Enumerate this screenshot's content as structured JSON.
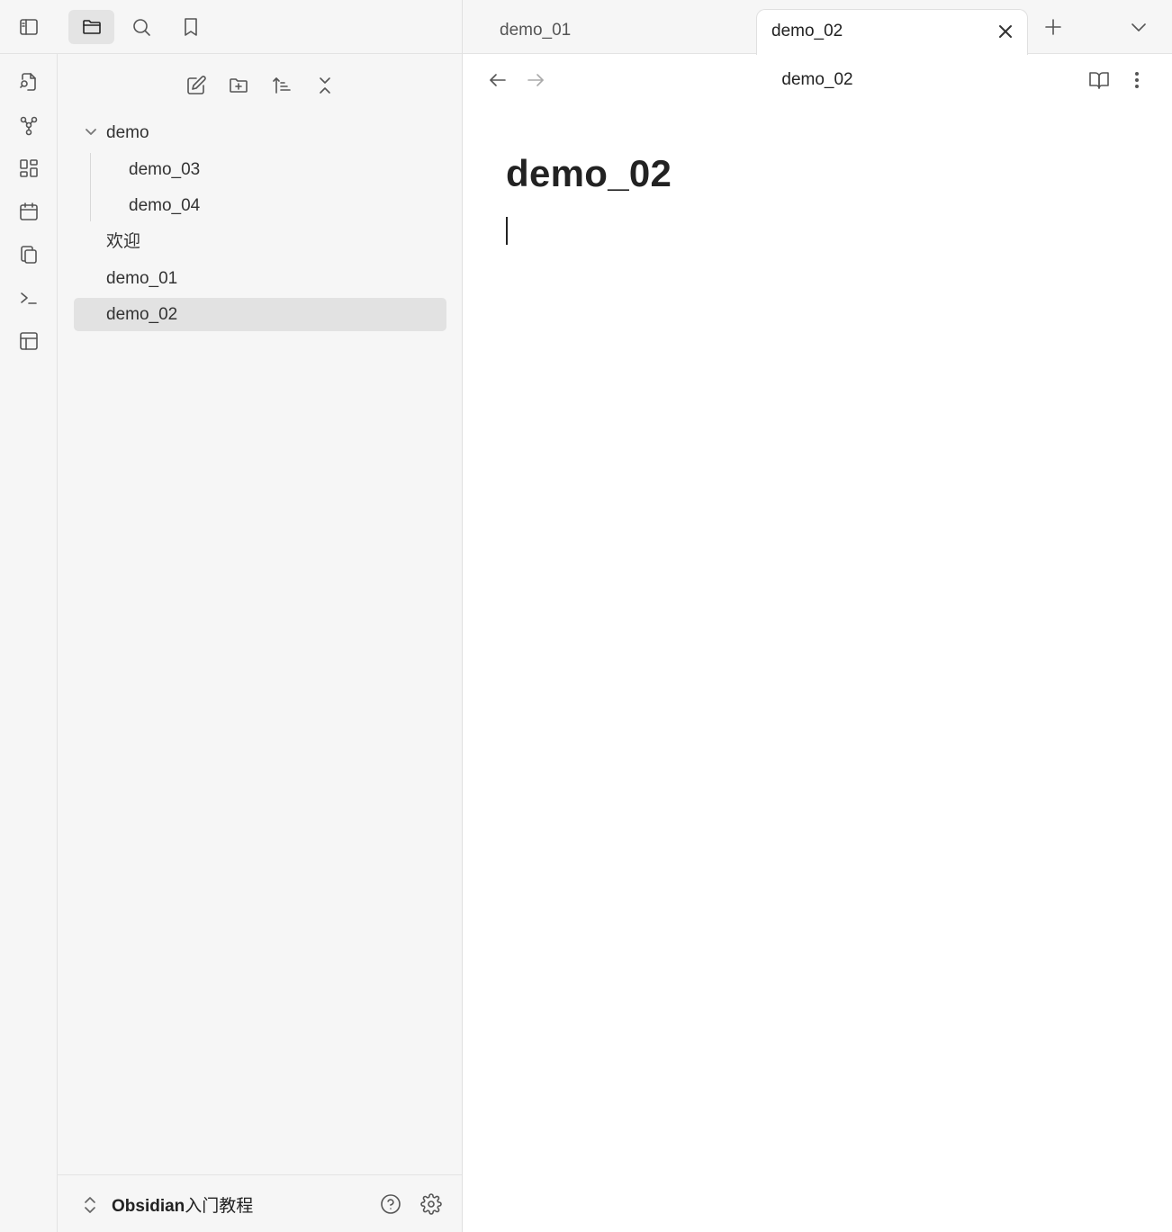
{
  "sidebar_header": {
    "icons": [
      "sidebar-toggle-icon",
      "folder-icon",
      "search-icon",
      "bookmark-icon"
    ],
    "active_tab": "files"
  },
  "ribbon": {
    "icons": [
      "open-quick-switcher-icon",
      "graph-view-icon",
      "canvas-icon",
      "daily-note-icon",
      "templates-icon",
      "command-palette-icon",
      "slides-icon"
    ]
  },
  "explorer": {
    "toolbar_icons": [
      "new-note-icon",
      "new-folder-icon",
      "sort-icon",
      "collapse-all-icon"
    ],
    "tree": {
      "folder": "demo",
      "folder_children": [
        "demo_03",
        "demo_04"
      ],
      "root_files": [
        "欢迎",
        "demo_01",
        "demo_02"
      ],
      "selected": "demo_02"
    }
  },
  "vault": {
    "name_bold": "Obsidian",
    "name_rest": "入门教程",
    "icons": [
      "help-icon",
      "settings-icon"
    ]
  },
  "tabs": [
    {
      "label": "demo_01",
      "active": false
    },
    {
      "label": "demo_02",
      "active": true
    }
  ],
  "view": {
    "title": "demo_02",
    "icons": [
      "back-arrow-icon",
      "forward-arrow-icon",
      "reading-view-icon",
      "more-options-icon"
    ]
  },
  "note": {
    "title": "demo_02",
    "body": ""
  },
  "colors": {
    "sidebar_bg": "#f6f6f6",
    "selected_bg": "#e2e2e2",
    "text": "#222222"
  }
}
